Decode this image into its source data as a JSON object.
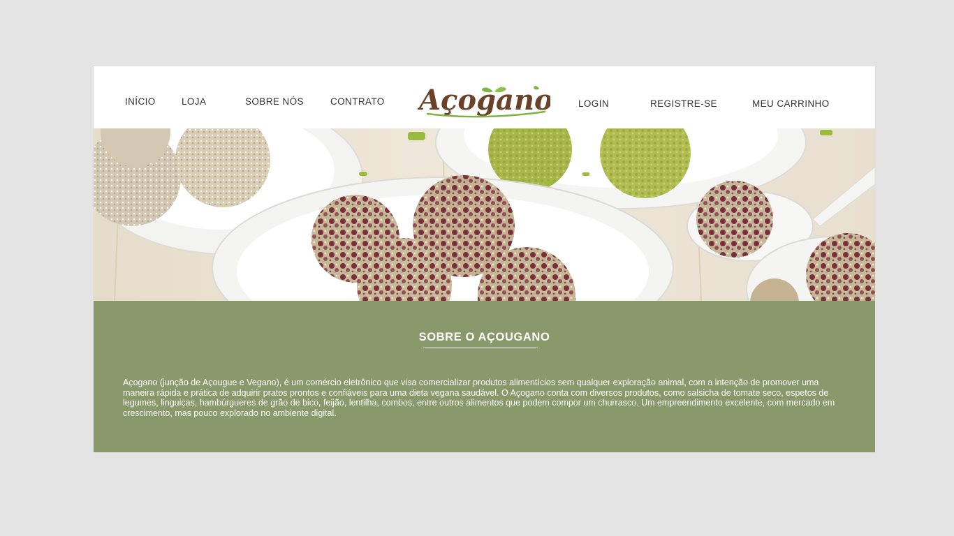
{
  "nav": {
    "left": [
      "INÍCIO",
      "LOJA",
      "SOBRE NÓS",
      "CONTRATO"
    ],
    "right": [
      "LOGIN",
      "REGISTRE-SE",
      "MEU CARRINHO"
    ]
  },
  "brand": {
    "logo_text": "Açogano",
    "logo_color": "#6b4128",
    "leaf_color": "#7cb342",
    "accent_color": "#d2453f"
  },
  "hero": {
    "image": "vegan-energy-balls-photo"
  },
  "about": {
    "title": "SOBRE O AÇOUGANO",
    "paragraph": "Açogano (junção de Açougue e Vegano), é um comércio eletrônico que visa comercializar produtos alimentícios sem qualquer exploração animal, com a intenção de promover uma maneira rápida e prática de adquirir pratos prontos e confiáveis para uma dieta vegana saudável. O Açogano conta com diversos produtos, como salsicha de tomate seco, espetos de legumes, linguiças, hambúrgueres de grão de bico, feijão, lentilha, combos, entre outros alimentos que podem compor um churrasco. Um empreendimento excelente, com mercado em crescimento, mas pouco explorado no ambiente digital.",
    "background": "#8a996b"
  },
  "colors": {
    "page_bg": "#e4e4e4",
    "nav_text": "#333333"
  }
}
